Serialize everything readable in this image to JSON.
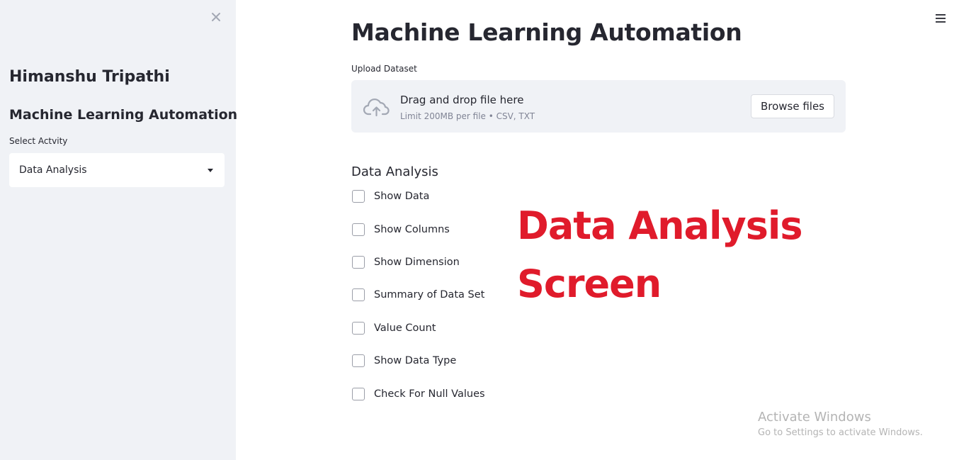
{
  "sidebar": {
    "user_name": "Himanshu Tripathi",
    "app_title": "Machine Learning Automation",
    "select_label": "Select Actvity",
    "select_value": "Data Analysis",
    "close_icon": "close-icon"
  },
  "header": {
    "menu_icon": "hamburger-menu-icon"
  },
  "main": {
    "title": "Machine Learning Automation",
    "uploader": {
      "label": "Upload Dataset",
      "drop_text": "Drag and drop file here",
      "limit_text": "Limit 200MB per file • CSV, TXT",
      "browse_label": "Browse files",
      "icon": "cloud-upload-icon"
    },
    "section_title": "Data Analysis",
    "checkboxes": [
      {
        "label": "Show Data",
        "checked": false
      },
      {
        "label": "Show Columns",
        "checked": false
      },
      {
        "label": "Show Dimension",
        "checked": false
      },
      {
        "label": "Summary of Data Set",
        "checked": false
      },
      {
        "label": "Value Count",
        "checked": false
      },
      {
        "label": "Show Data Type",
        "checked": false
      },
      {
        "label": "Check For Null Values",
        "checked": false
      }
    ]
  },
  "annotation": {
    "line1": "Data Analysis",
    "line2": "Screen",
    "color": "#e01b2b"
  },
  "watermark": {
    "title": "Activate Windows",
    "subtitle": "Go to Settings to activate Windows."
  },
  "colors": {
    "sidebar_bg": "#f0f2f6",
    "text": "#262730",
    "muted": "#808495"
  }
}
